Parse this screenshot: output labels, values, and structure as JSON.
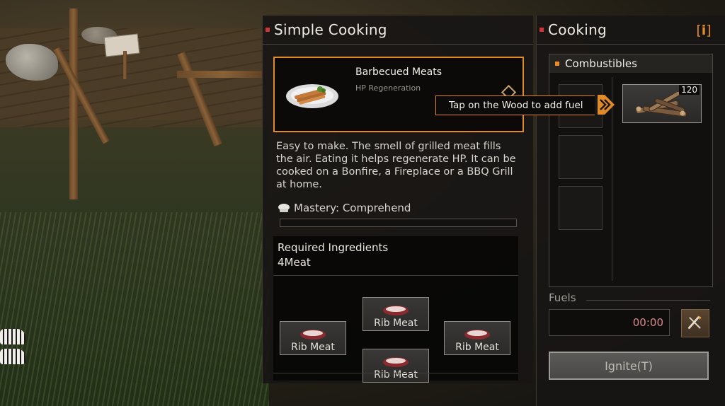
{
  "cooking_panel": {
    "title": "Simple Cooking",
    "recipe": {
      "name": "Barbecued Meats",
      "effect": "HP Regeneration",
      "icon": "bbq-meat-plate-icon"
    },
    "description": "Easy to make. The smell of grilled meat fills the air. Eating it helps regenerate HP. It can be cooked on a Bonfire, a Fireplace or a BBQ Grill at home.",
    "mastery_label": "Mastery: Comprehend",
    "mastery_progress": 0,
    "ingredients": {
      "title": "Required Ingredients",
      "requirement": "4Meat",
      "items": [
        {
          "label": "Rib Meat"
        },
        {
          "label": "Rib Meat"
        },
        {
          "label": "Rib Meat"
        },
        {
          "label": "Rib Meat"
        }
      ]
    }
  },
  "tooltip": {
    "text": "Tap on the Wood to add fuel"
  },
  "fuel_panel": {
    "title": "Cooking",
    "info_label": "i",
    "combustibles_title": "Combustibles",
    "wood": {
      "count": "120",
      "icon": "wood-logs-icon"
    },
    "fuels_label": "Fuels",
    "fuel_time": "00:00",
    "ignite_label": "Ignite(T)"
  },
  "colors": {
    "accent": "#e08a2a",
    "title_bullet": "#d0353a",
    "timer_text": "#d88a8a"
  }
}
